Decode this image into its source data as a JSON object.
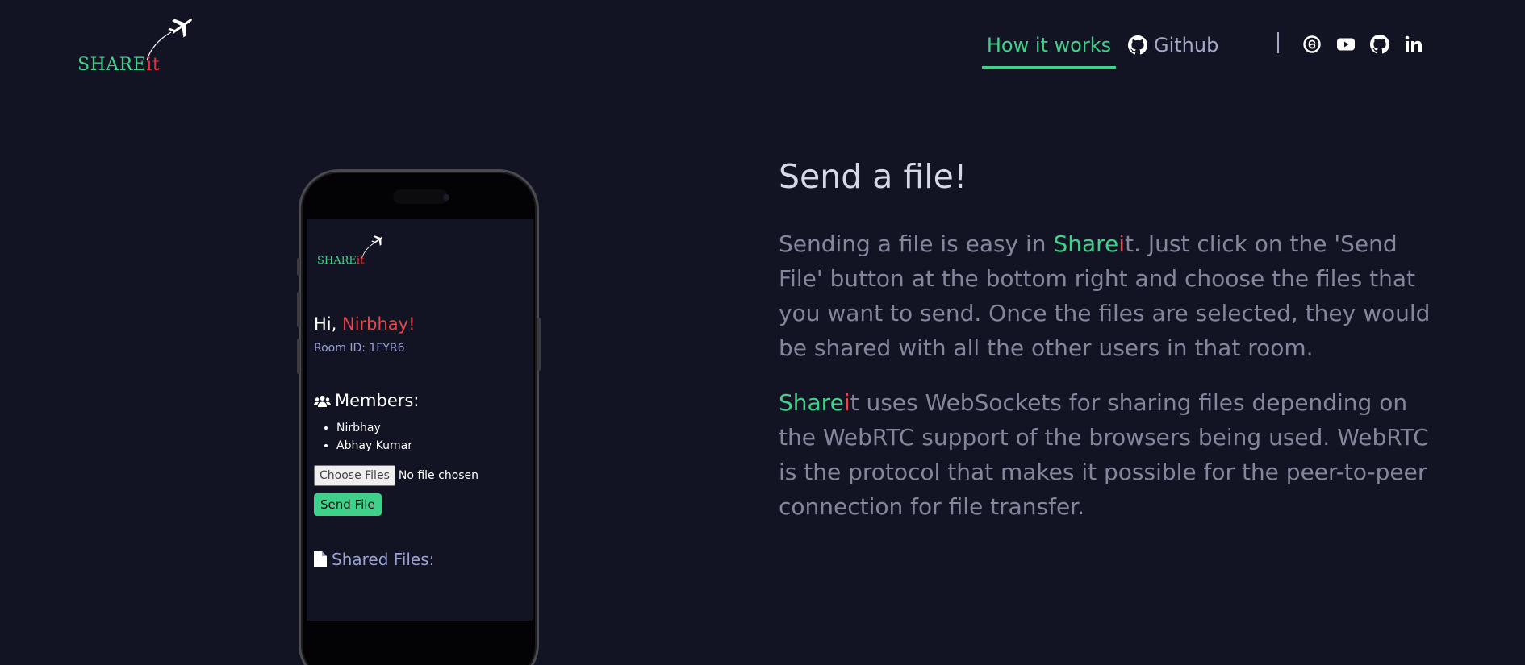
{
  "logo": {
    "text_main": "SHARE",
    "text_accent": "it"
  },
  "nav": {
    "how_it_works": "How it works",
    "github": "Github"
  },
  "social": [
    "threads-icon",
    "youtube-icon",
    "github-icon",
    "linkedin-icon"
  ],
  "colors": {
    "background": "#121424",
    "accent_green": "#3fd18a",
    "accent_red": "#e5484d",
    "muted": "#84879c"
  },
  "phone": {
    "logo_main": "SHARE",
    "logo_accent": "it",
    "greeting": "Hi, ",
    "user_name": "Nirbhay!",
    "room_id": "Room ID: 1FYR6",
    "members_title": "Members:",
    "members": [
      "Nirbhay",
      "Abhay Kumar"
    ],
    "choose_files": "Choose Files",
    "no_file": "No file chosen",
    "send_file": "Send File",
    "shared_files": "Shared Files:"
  },
  "content": {
    "heading": "Send a file!",
    "p1_before": "Sending a file is easy in ",
    "brand_share": "Share",
    "brand_it": "i",
    "p1_after": "t. Just click on the 'Send File' button at the bottom right and choose the files that you want to send. Once the files are selected, they would be shared with all the other users in that room.",
    "p2_after": "t uses WebSockets for sharing files depending on the WebRTC support of the browsers being used. WebRTC is the protocol that makes it possible for the peer-to-peer connection for file transfer."
  }
}
